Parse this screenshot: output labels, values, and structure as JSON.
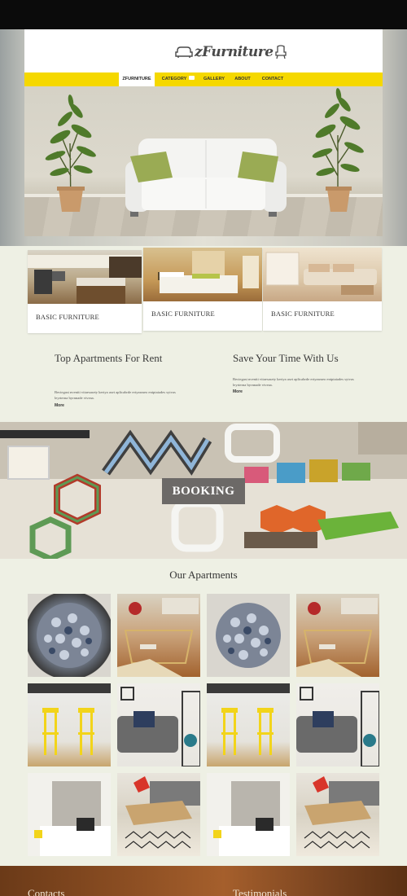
{
  "brand": {
    "name": "zFurniture"
  },
  "nav": {
    "items": [
      {
        "label": "ZFURNITURE",
        "active": true
      },
      {
        "label": "CATEGORY",
        "active": false,
        "has_dropdown": true
      },
      {
        "label": "GALLERY",
        "active": false
      },
      {
        "label": "ABOUT",
        "active": false
      },
      {
        "label": "CONTACT",
        "active": false
      }
    ]
  },
  "cards": [
    {
      "title": "BASIC FURNITURE"
    },
    {
      "title": "BASIC FURNITURE"
    },
    {
      "title": "BASIC FURNITURE"
    }
  ],
  "info": [
    {
      "title": "Top Apartments For Rent",
      "body": "Beciegast nveniti vitaesasety kertya aset aplicabrde ertyasmeo eniptaiades sytvas leyrterna byrnnade viveaa.",
      "link": "More"
    },
    {
      "title": "Save Your Time With Us",
      "body": "Beciegast nveniti vitaesasety kertya aset aplicabrde ertyasmeo eniptaiades sytvas leyrterna byrnnade viveaa.",
      "link": "More"
    }
  ],
  "booking": {
    "label": "BOOKING"
  },
  "apartments": {
    "title": "Our Apartments"
  },
  "footer": {
    "col1": "Contacts",
    "col2": "Testimonials"
  },
  "colors": {
    "accent_yellow": "#f5d800",
    "background": "#eef0e4",
    "booking_button": "#6c6967",
    "footer_brown": "#8a4d22"
  }
}
